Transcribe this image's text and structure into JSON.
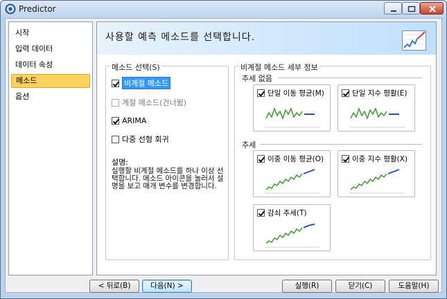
{
  "window": {
    "title": "Predictor",
    "icon": "predictor-app-icon",
    "controls": [
      "minimize-icon",
      "maximize-icon",
      "close-icon"
    ]
  },
  "nav": {
    "items": [
      {
        "label": "시작",
        "active": false
      },
      {
        "label": "입력 데이터",
        "active": false
      },
      {
        "label": "데이터 속성",
        "active": false
      },
      {
        "label": "메소드",
        "active": true
      },
      {
        "label": "옵션",
        "active": false
      }
    ]
  },
  "banner": {
    "text": "사용할 예측 메소드를 선택합니다.",
    "icon": "forecast-chart-icon"
  },
  "method_select": {
    "legend": "메소드 선택(S)",
    "options": [
      {
        "label": "비계절 메소드",
        "checked": true,
        "selected": true,
        "enabled": true
      },
      {
        "label": "계절 메소드(건너뜀)",
        "checked": false,
        "selected": false,
        "enabled": false
      },
      {
        "label": "ARIMA",
        "checked": true,
        "selected": false,
        "enabled": true
      },
      {
        "label": "다중 선형 회귀",
        "checked": false,
        "selected": false,
        "enabled": true
      }
    ],
    "description_title": "설명:",
    "description_text": "실행할 비계절 메소드를 하나 이상 선택합니다. 메소드 아이콘을 눌러서 설명을 보고 매개 변수를 변경합니다."
  },
  "details": {
    "legend": "비계절 메소드 세부 정보",
    "sections": [
      {
        "title": "추세 없음",
        "cards": [
          {
            "label": "단일 이동 평균(M)",
            "checked": true,
            "trend": "flat"
          },
          {
            "label": "단일 지수 평활(E)",
            "checked": true,
            "trend": "flat"
          }
        ]
      },
      {
        "title": "추세",
        "cards": [
          {
            "label": "이중 이동 평균(O)",
            "checked": true,
            "trend": "up"
          },
          {
            "label": "이중 지수 평활(X)",
            "checked": true,
            "trend": "up"
          },
          {
            "label": "감쇠 추세(T)",
            "checked": true,
            "trend": "up"
          }
        ]
      }
    ]
  },
  "footer": {
    "back": "< 뒤로(B)",
    "next": "다음(N) >",
    "run": "실행(R)",
    "close": "닫기(C)",
    "help": "도움말(H)"
  },
  "colors": {
    "active_nav": "#fbd25c",
    "selection": "#3399ff",
    "history_line": "#3a9a2e",
    "forecast_line": "#2b4fb0"
  }
}
